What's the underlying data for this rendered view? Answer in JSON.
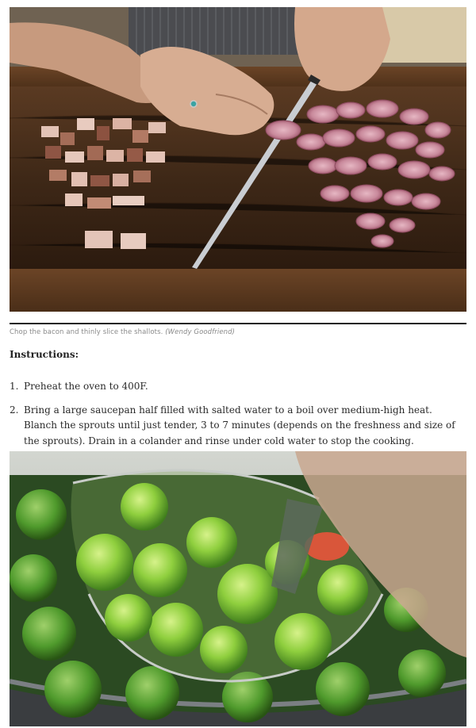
{
  "photo1": {
    "alt_icon": "cutting-board-photo-icon"
  },
  "caption": {
    "text": "Chop the bacon and thinly slice the shallots.",
    "credit": "(Wendy Goodfriend)"
  },
  "instructions": {
    "heading": "Instructions:",
    "steps": [
      {
        "number": "1.",
        "text": "Preheat the oven to 400F."
      },
      {
        "number": "2.",
        "text": "Bring a large saucepan half filled with salted water to a boil over medium-high heat. Blanch the sprouts until just tender, 3 to 7 minutes (depends on the freshness and size of the sprouts). Drain in a colander and rinse under cold water to stop the cooking."
      }
    ]
  },
  "photo2": {
    "alt_icon": "brussels-sprouts-strainer-photo-icon"
  },
  "colors": {
    "rule": "#222222",
    "caption": "#8a8a8a",
    "text": "#2a2a2a"
  }
}
